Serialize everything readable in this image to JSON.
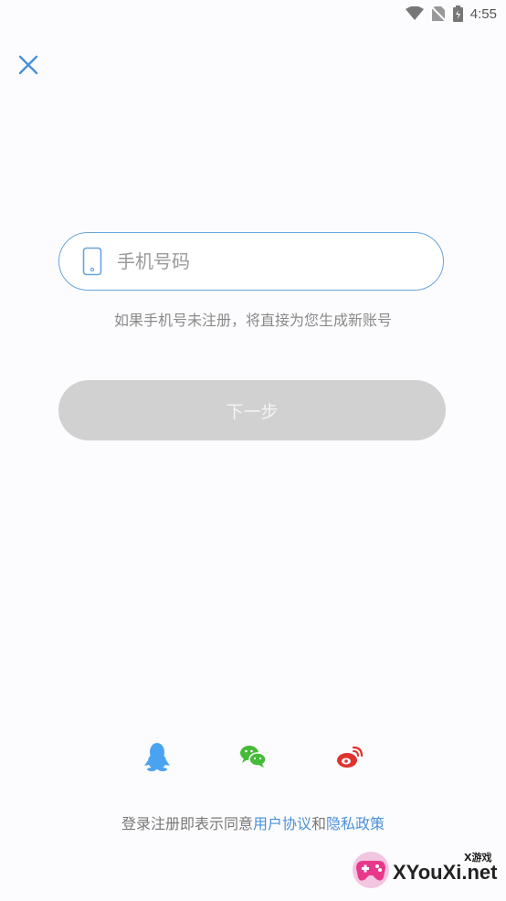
{
  "status_bar": {
    "time": "4:55"
  },
  "phone_field": {
    "placeholder": "手机号码",
    "value": ""
  },
  "hint": "如果手机号未注册，将直接为您生成新账号",
  "next_button": {
    "label": "下一步"
  },
  "social_login": [
    "qq-icon",
    "wechat-icon",
    "weibo-icon"
  ],
  "agreement": {
    "prefix": "登录注册即表示同意",
    "user_agreement": "用户协议",
    "conjunction": "和",
    "privacy_policy": "隐私政策"
  },
  "watermark": {
    "brand": "XYouXi.net",
    "tag": "X游戏"
  },
  "colors": {
    "accent": "#4a90d9",
    "input_border": "#6aa4da",
    "button_disabled": "#d1d1d1",
    "qq": "#4aa3f0",
    "wechat": "#46bb37",
    "weibo": "#e0322d"
  }
}
